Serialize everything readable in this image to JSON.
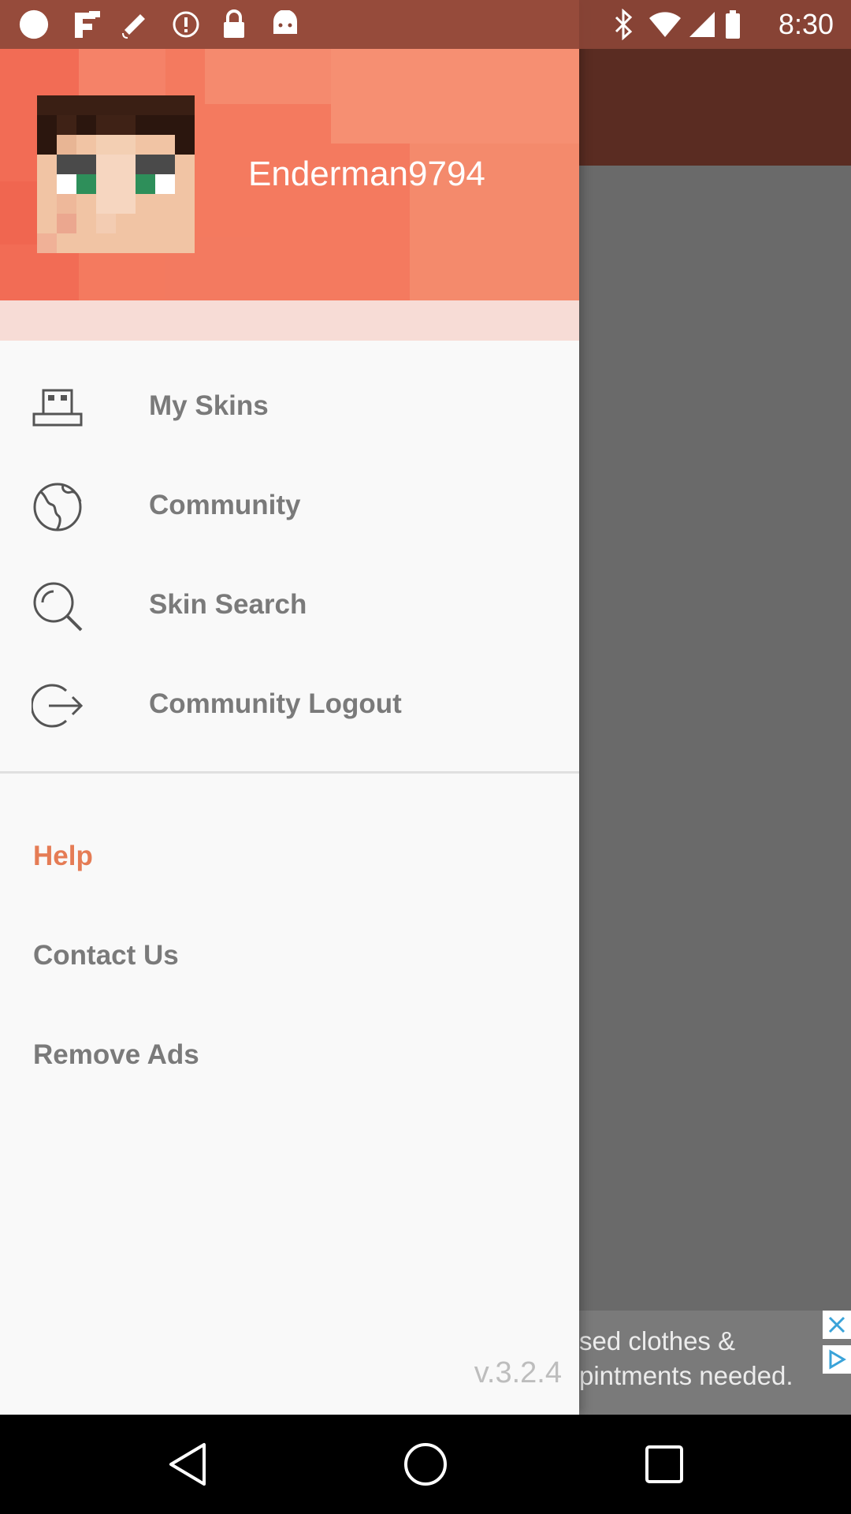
{
  "status_bar": {
    "time": "8:30",
    "icons": [
      "circle-icon",
      "fake-gps-icon",
      "satellite-icon",
      "alert-icon",
      "lock-icon",
      "android-icon",
      "bluetooth-icon",
      "wifi-icon",
      "signal-icon",
      "battery-icon"
    ]
  },
  "drawer": {
    "header": {
      "username": "Enderman9794",
      "background_color": "#f47a5f"
    },
    "menu": [
      {
        "label": "My Skins",
        "icon": "skins-icon"
      },
      {
        "label": "Community",
        "icon": "globe-icon"
      },
      {
        "label": "Skin Search",
        "icon": "search-icon"
      },
      {
        "label": "Community Logout",
        "icon": "logout-icon"
      }
    ],
    "secondary": [
      {
        "label": "Help"
      },
      {
        "label": "Contact Us"
      },
      {
        "label": "Remove Ads"
      }
    ],
    "version": "v.3.2.4",
    "accent_color": "#e57c55"
  },
  "ad": {
    "line1": "sed clothes &",
    "line2": "pintments needed."
  },
  "nav_bar": {
    "buttons": [
      "back-icon",
      "home-icon",
      "recents-icon"
    ]
  }
}
